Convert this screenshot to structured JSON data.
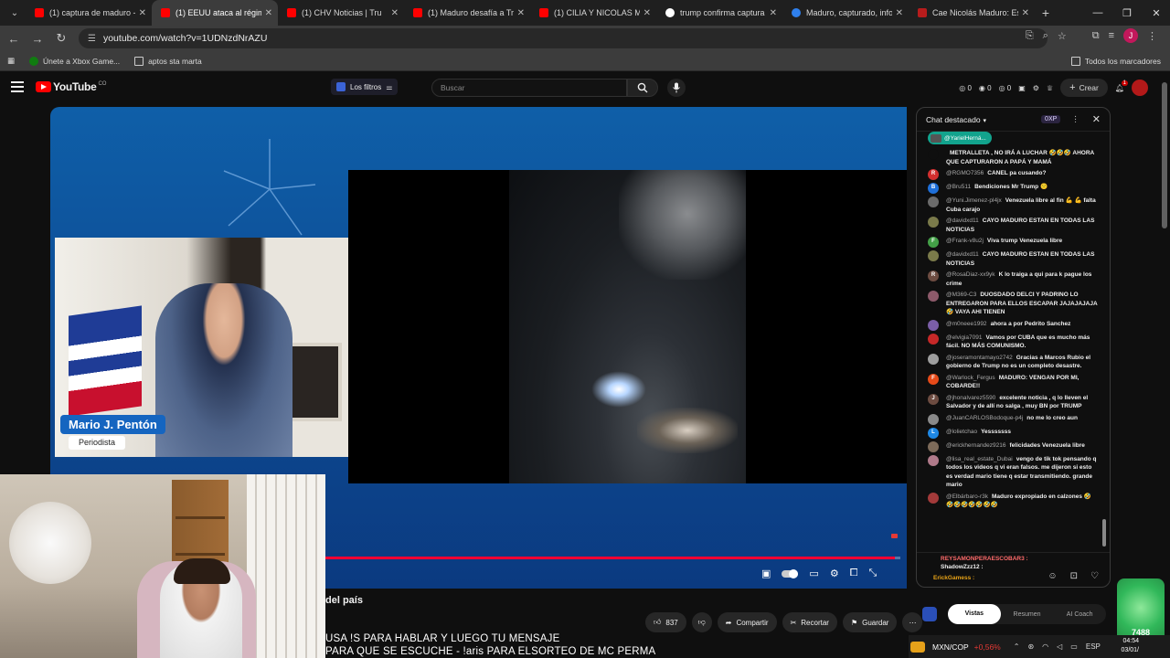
{
  "browser": {
    "tabs": [
      {
        "label": "(1) captura de maduro - Y",
        "active": false
      },
      {
        "label": "(1) EEUU ataca al régimen",
        "active": true
      },
      {
        "label": "(1) CHV Noticias | Tru",
        "active": false
      },
      {
        "label": "(1) Maduro desafía a Trum",
        "active": false
      },
      {
        "label": "(1) CILIA Y NICOLAS MADU",
        "active": false
      },
      {
        "label": "trump confirma captura d",
        "active": false
      },
      {
        "label": "Maduro, capturado, infor",
        "active": false
      },
      {
        "label": "Cae Nicolás Maduro: Esta",
        "active": false
      }
    ],
    "url": "youtube.com/watch?v=1UDNzdNrAZU",
    "bookmarks": [
      "Únete a Xbox Game...",
      "aptos sta marta"
    ],
    "all_bookmarks": "Todos los marcadores",
    "profile_initial": "J"
  },
  "yt": {
    "logo": "YouTube",
    "logo_country": "CO",
    "filters_label": "Los filtros",
    "search_placeholder": "Buscar",
    "counters": [
      "0",
      "0",
      "0"
    ],
    "create_label": "Crear",
    "notif_count": "1"
  },
  "video": {
    "name_plate": "Mario J. Pentón",
    "role": "Periodista",
    "progress_fraction": 0.99,
    "title_fragment": "del país"
  },
  "actions": {
    "likes": "837",
    "share": "Compartir",
    "clip": "Recortar",
    "save": "Guardar"
  },
  "subtitle": {
    "line1": "USA !S PARA HABLAR Y LUEGO TU MENSAJE",
    "line2": "PARA QUE SE ESCUCHE - !aris PARA ELSORTEO DE MC PERMA"
  },
  "chat": {
    "header": "Chat destacado",
    "xp": "0XP",
    "pinned": "@YarielHerná...",
    "messages": [
      {
        "user": "",
        "text": "METRALLETA , NO IRÁ A LUCHAR 🤣🤣🤣 AHORA QUE CAPTURARON A PAPÁ Y MAMÁ",
        "initial": "",
        "color": "#0f0f0f"
      },
      {
        "user": "@RGMO7356",
        "text": "CANEL pa cusando?",
        "initial": "R",
        "color": "#d32f2f"
      },
      {
        "user": "@Bru511",
        "text": "Bendiciones Mr Trump 🙁",
        "initial": "B",
        "color": "#1e6fd9"
      },
      {
        "user": "@Yuni.Jimenez-pl4jx",
        "text": "Venezuela libre al fin 💪 💪 falta Cuba carajo",
        "initial": "",
        "color": "#6b6b6b"
      },
      {
        "user": "@davidxd11",
        "text": "CAYO MADURO ESTAN EN TODAS LAS NOTICIAS",
        "initial": "",
        "color": "#7a7a4a"
      },
      {
        "user": "@Frank-v8u2j",
        "text": "Viva trump Venezuela libre",
        "initial": "F",
        "color": "#43a047"
      },
      {
        "user": "@davidxd11",
        "text": "CAYO MADURO ESTAN EN TODAS LAS NOTICIAS",
        "initial": "",
        "color": "#7a7a4a"
      },
      {
        "user": "@RosaDiaz-xx9yk",
        "text": "K lo traiga a qui para k pague los crime",
        "initial": "R",
        "color": "#6d4c41"
      },
      {
        "user": "@M369-C3",
        "text": "DUOSDADO DELCI Y PADRINO LO ENTREGARON PARA ELLOS ESCAPAR JAJAJAJAJA 🤣 VAYA AHI TIENEN",
        "initial": "",
        "color": "#8d5a6a"
      },
      {
        "user": "@m0neee1992",
        "text": "ahora a por Pedrito Sanchez",
        "initial": "",
        "color": "#7b5ea7"
      },
      {
        "user": "@elvigia7091",
        "text": "Vamos por CUBA que es mucho más fácil. NO MÁS COMUNISMO.",
        "initial": "",
        "color": "#c62828"
      },
      {
        "user": "@joseramontamayo2742",
        "text": "Gracias a Marcos Rubio el gobierno de Trump no es un completo desastre.",
        "initial": "",
        "color": "#9e9e9e"
      },
      {
        "user": "@Warlock_Fergus",
        "text": "MADURO: VENGAN POR MI, COBARDE!!",
        "initial": "F",
        "color": "#e64a19"
      },
      {
        "user": "@jhonalvarez5590",
        "text": "excelente noticia , q lo lleven el Salvador y de allí no salga , muy BN por TRUMP",
        "initial": "J",
        "color": "#6d4c41"
      },
      {
        "user": "@JuanCARLOSBodoque-p4j",
        "text": "no me lo creo aun",
        "initial": "",
        "color": "#8a8a8a"
      },
      {
        "user": "@lolietchao",
        "text": "Yesssssss",
        "initial": "L",
        "color": "#1e88e5"
      },
      {
        "user": "@erickhernandez9216",
        "text": "felicidades Venezuela libre",
        "initial": "",
        "color": "#7d6b5a"
      },
      {
        "user": "@lisa_real_estate_Dubai",
        "text": "vengo de tik tok pensando q todos los videos q vi eran falsos. me dijeron si esto es verdad mario tiene q estar transmitiendo. grande mario",
        "initial": "",
        "color": "#b07a8a"
      },
      {
        "user": "@Elbárbaro-r3k",
        "text": "Maduro expropiado en calzones 🤣🤣🤣🤣🤣🤣🤣🤣",
        "initial": "",
        "color": "#a33a3a"
      }
    ],
    "footer": {
      "line1": "REYSAMONPERAESCOBAR3 :",
      "line2": "ShadowZzz12 :",
      "line3": "ErickGamess :"
    },
    "subtabs": [
      "Vistas",
      "Resumen",
      "AI Coach"
    ]
  },
  "taskbar": {
    "ticker": "MXN/COP",
    "change": "+0,56%",
    "lang": "ESP",
    "time": "04:54",
    "date": "03/01/"
  },
  "widget_value": "7488"
}
